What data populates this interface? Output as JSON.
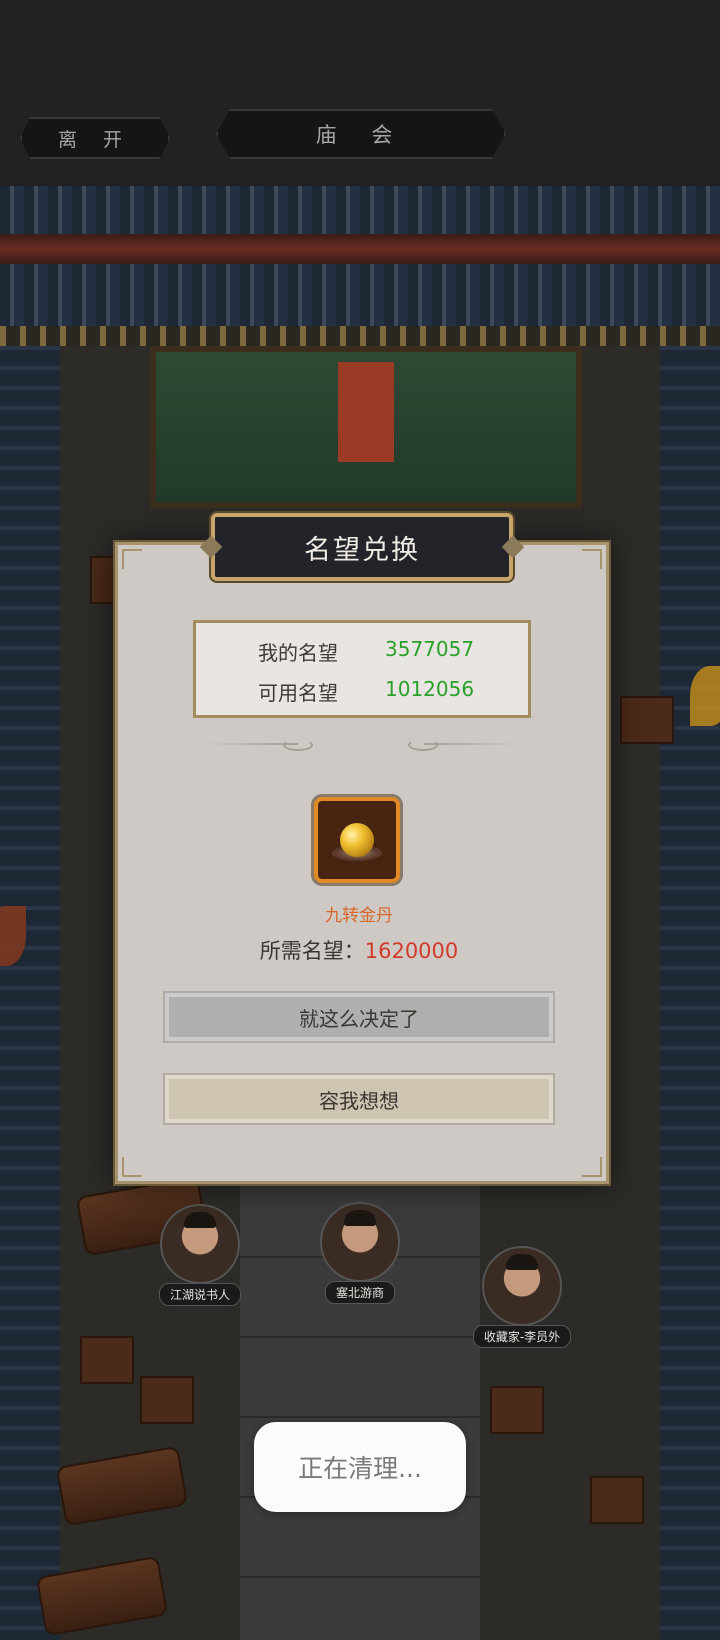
{
  "header": {
    "leave_label": "离 开",
    "title": "庙 会"
  },
  "npcs": [
    {
      "name": "江湖说书人"
    },
    {
      "name": "塞北游商"
    },
    {
      "name": "收藏家-李员外"
    }
  ],
  "dialog": {
    "title": "名望兑换",
    "stats": [
      {
        "label": "我的名望",
        "value": "3577057"
      },
      {
        "label": "可用名望",
        "value": "1012056"
      }
    ],
    "item": {
      "icon": "golden-pill-icon",
      "name": "九转金丹"
    },
    "cost": {
      "label": "所需名望：",
      "value": "1620000"
    },
    "confirm_label": "就这么决定了",
    "cancel_label": "容我想想"
  },
  "toast": {
    "text": "正在清理..."
  },
  "colors": {
    "stat_value": "#2aa02a",
    "cost_value": "#d23a2a",
    "item_name": "#d6672a",
    "frame_gold": "#c6a46a"
  }
}
